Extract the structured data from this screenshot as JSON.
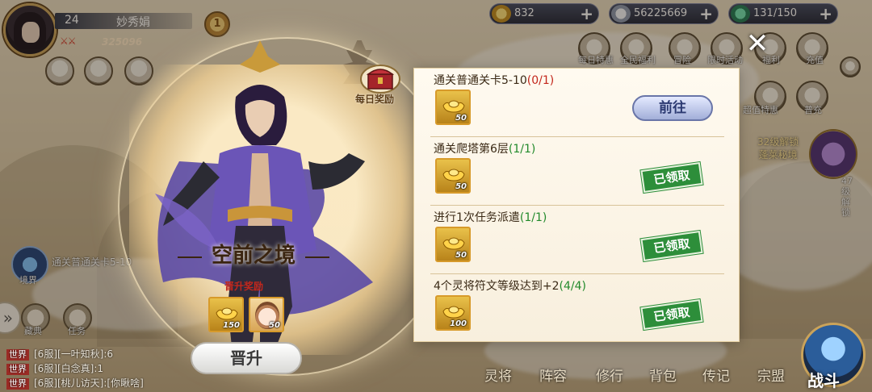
{
  "player": {
    "level": "24",
    "name": "妙秀娟",
    "power_value": "325096",
    "vip": "1"
  },
  "resources": [
    {
      "name": "gold-ingot",
      "value": "832"
    },
    {
      "name": "silver",
      "value": "56225669"
    },
    {
      "name": "jade-gourd",
      "value": "131/150"
    }
  ],
  "right_icons": [
    "每日特惠",
    "全民福利",
    "冒险",
    "限时活动",
    "福利",
    "充值"
  ],
  "right_icons_row2": [
    "超值特惠",
    "普充"
  ],
  "side_event": {
    "line1": "32级解锁",
    "line2": "蓬莱秘境",
    "small": "47级解锁"
  },
  "left_side": {
    "realm_label": "境界",
    "task_hint": "通关普通关卡5-10",
    "btn1": "藏典",
    "btn2": "任务",
    "level_small": "33级"
  },
  "modal": {
    "daily_reward_label": "每日奖励",
    "realm_title": "空前之境",
    "advance_reward_label": "晋升奖励",
    "advance_items": [
      {
        "icon": "gold-ingot-icon",
        "count": "150"
      },
      {
        "icon": "portrait-icon",
        "count": "50"
      }
    ],
    "advance_button": "晋升",
    "tasks": [
      {
        "title": "通关普通关卡5-10",
        "progress": "(0/1)",
        "progress_color": "#c3271c",
        "reward_count": "50",
        "action": "前往",
        "status": "go"
      },
      {
        "title": "通关爬塔第6层",
        "progress": "(1/1)",
        "progress_color": "#228a2b",
        "reward_count": "50",
        "action": "已领取",
        "status": "claimed"
      },
      {
        "title": "进行1次任务派遣",
        "progress": "(1/1)",
        "progress_color": "#228a2b",
        "reward_count": "50",
        "action": "已领取",
        "status": "claimed"
      },
      {
        "title": "4个灵将符文等级达到+2",
        "progress": "(4/4)",
        "progress_color": "#228a2b",
        "reward_count": "100",
        "action": "已领取",
        "status": "claimed"
      }
    ]
  },
  "chat": [
    {
      "channel": "世界",
      "text": "[6服][一叶知秋]:6"
    },
    {
      "channel": "世界",
      "text": "[6服][白念真]:1"
    },
    {
      "channel": "世界",
      "text": "[6服][桃儿访天]:[你瞅啥]"
    }
  ],
  "bottom_nav": [
    "灵将",
    "阵容",
    "修行",
    "背包",
    "传记",
    "宗盟"
  ],
  "battle_label": "战斗",
  "colors": {
    "accent_gold": "#d79a2a",
    "claimed_green": "#2d8e3a",
    "progress_red": "#c3271c",
    "progress_green": "#228a2b"
  }
}
